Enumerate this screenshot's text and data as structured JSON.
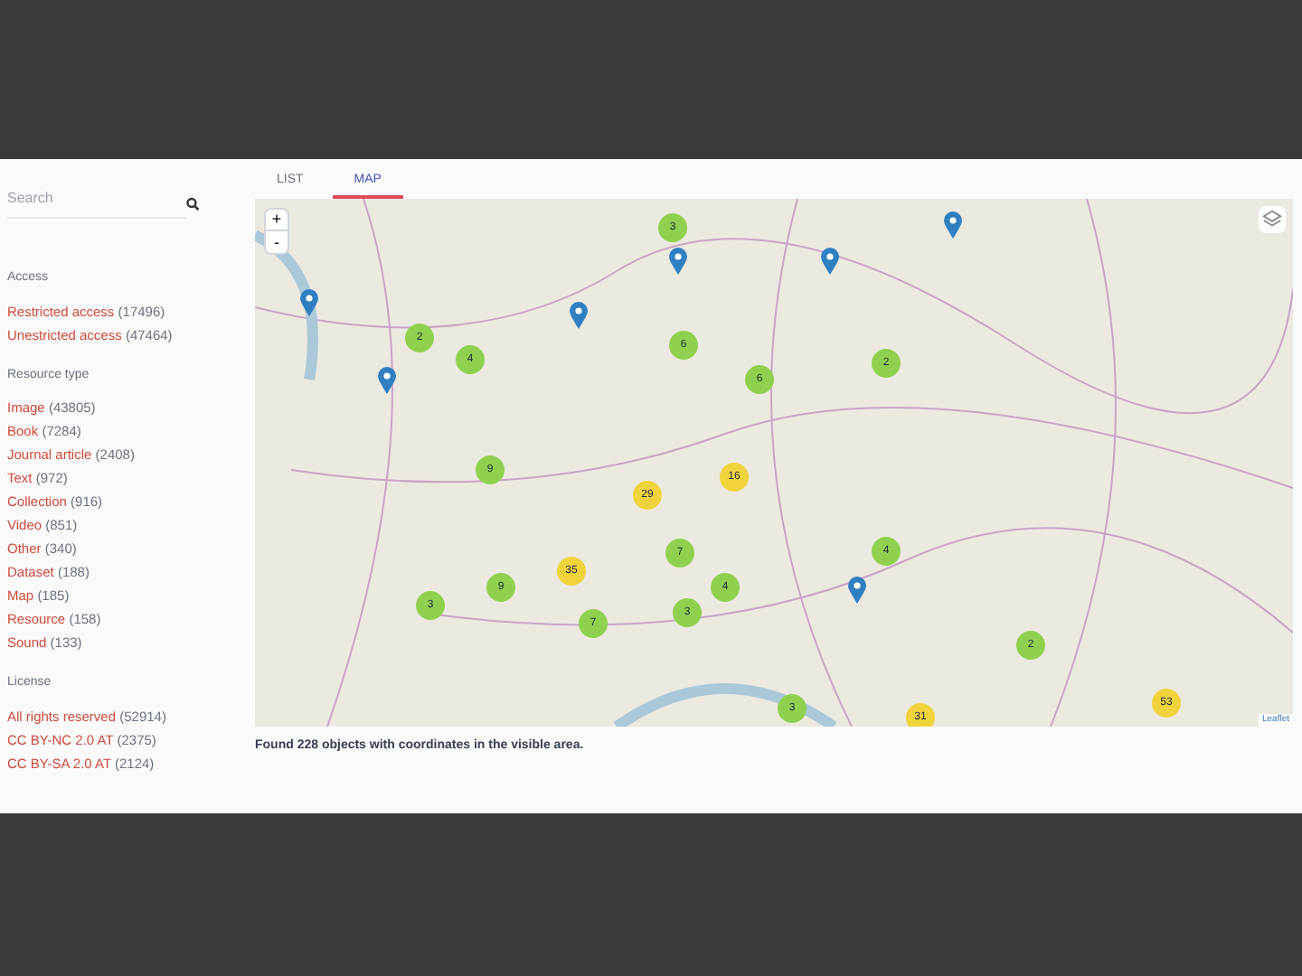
{
  "search": {
    "placeholder": "Search"
  },
  "facets": [
    {
      "title": "Access",
      "items": [
        {
          "label": "Restricted access",
          "count": "(17496)"
        },
        {
          "label": "Unestricted access",
          "count": "(47464)"
        }
      ]
    },
    {
      "title": "Resource type",
      "items": [
        {
          "label": "Image",
          "count": "(43805)"
        },
        {
          "label": "Book",
          "count": "(7284)"
        },
        {
          "label": "Journal article",
          "count": "(2408)"
        },
        {
          "label": "Text",
          "count": "(972)"
        },
        {
          "label": "Collection",
          "count": "(916)"
        },
        {
          "label": "Video",
          "count": "(851)"
        },
        {
          "label": "Other",
          "count": "(340)"
        },
        {
          "label": "Dataset",
          "count": "(188)"
        },
        {
          "label": "Map",
          "count": "(185)"
        },
        {
          "label": "Resource",
          "count": "(158)"
        },
        {
          "label": "Sound",
          "count": "(133)"
        }
      ]
    },
    {
      "title": "License",
      "items": [
        {
          "label": "All rights reserved",
          "count": "(52914)"
        },
        {
          "label": "CC BY-NC 2.0 AT",
          "count": "(2375)"
        },
        {
          "label": "CC BY-SA 2.0 AT",
          "count": "(2124)"
        }
      ]
    }
  ],
  "tabs": [
    {
      "label": "LIST",
      "selected": false
    },
    {
      "label": "MAP",
      "selected": true
    }
  ],
  "map": {
    "zoom_in": "+",
    "zoom_out": "-",
    "attribution": "Leaflet",
    "clusters": [
      {
        "count": "3",
        "color": "#8fd14f"
      },
      {
        "count": "2",
        "color": "#8fd14f"
      },
      {
        "count": "4",
        "color": "#8fd14f"
      },
      {
        "count": "6",
        "color": "#8fd14f"
      },
      {
        "count": "6",
        "color": "#8fd14f"
      },
      {
        "count": "2",
        "color": "#8fd14f"
      },
      {
        "count": "9",
        "color": "#8fd14f"
      },
      {
        "count": "29",
        "color": "#f1d33c"
      },
      {
        "count": "16",
        "color": "#f1d33c"
      },
      {
        "count": "7",
        "color": "#8fd14f"
      },
      {
        "count": "4",
        "color": "#8fd14f"
      },
      {
        "count": "35",
        "color": "#f1d33c"
      },
      {
        "count": "9",
        "color": "#8fd14f"
      },
      {
        "count": "3",
        "color": "#8fd14f"
      },
      {
        "count": "4",
        "color": "#8fd14f"
      },
      {
        "count": "7",
        "color": "#8fd14f"
      },
      {
        "count": "3",
        "color": "#8fd14f"
      },
      {
        "count": "2",
        "color": "#8fd14f"
      },
      {
        "count": "3",
        "color": "#8fd14f"
      },
      {
        "count": "31",
        "color": "#f1d33c"
      },
      {
        "count": "53",
        "color": "#f1d33c"
      }
    ]
  },
  "result_text": "Found 228 objects with coordinates in the visible area."
}
